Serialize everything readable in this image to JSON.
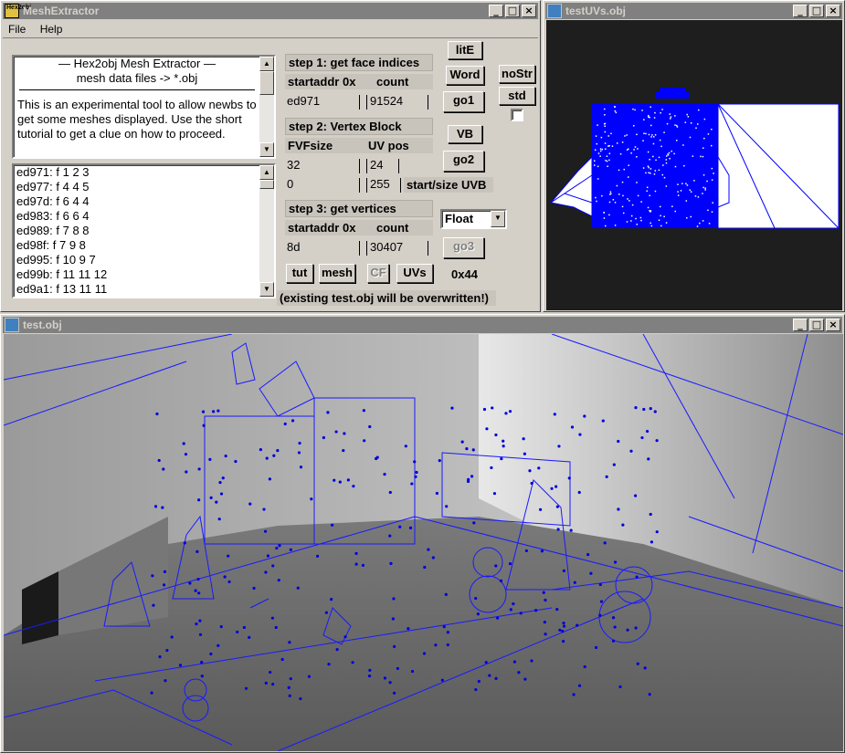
{
  "main_window": {
    "title": "MeshExtractor",
    "app_icon_text": "Hex2obj",
    "menu": [
      "File",
      "Help"
    ],
    "info": {
      "heading1": "—   Hex2obj Mesh Extractor   —",
      "heading2": "mesh data files -> *.obj",
      "body": "This is an experimental tool to allow newbs to get some meshes displayed. Use the short tutorial to get a clue on how to proceed."
    },
    "face_list": [
      "ed971: f  1 2 3",
      "ed977: f  4 4 5",
      "ed97d: f  6 4 4",
      "ed983: f  6 6 4",
      "ed989: f  7 8 8",
      "ed98f: f  7 9 8",
      "ed995: f  10 9 7",
      "ed99b: f  11 11 12",
      "ed9a1: f  13 11 11"
    ],
    "step1": {
      "title": "step 1: get face indices",
      "startaddr_label": "startaddr 0x",
      "count_label": "count",
      "startaddr": "ed971",
      "count": "91524"
    },
    "step2": {
      "title": "step 2: Vertex Block",
      "fvf_label": "FVFsize",
      "uvpos_label": "UV pos",
      "fvf": "32",
      "uvpos": "24",
      "start": "0",
      "size": "255",
      "start_size_label": "start/size UVB"
    },
    "step3": {
      "title": "step 3: get vertices",
      "startaddr_label": "startaddr 0x",
      "count_label": "count",
      "startaddr": "8d",
      "count": "30407",
      "format_selected": "Float"
    },
    "buttons": {
      "lite": "litE",
      "word": "Word",
      "go1": "go1",
      "vb": "VB",
      "go2": "go2",
      "go3": "go3",
      "nostr": "noStr",
      "std": "std",
      "tut": "tut",
      "mesh": "mesh",
      "cf": "CF",
      "uvs": "UVs"
    },
    "hex_readout": "0x44",
    "warning": "(existing test.obj will be overwritten!)"
  },
  "uv_window": {
    "title": "testUVs.obj"
  },
  "obj_window": {
    "title": "test.obj"
  },
  "window_buttons": {
    "minimize": "_",
    "maximize": "□",
    "close": "×"
  },
  "colors": {
    "wireframe": "#0000ff",
    "titlebar_inactive": "#808080",
    "viewport_bg": "#1e1e1e"
  }
}
